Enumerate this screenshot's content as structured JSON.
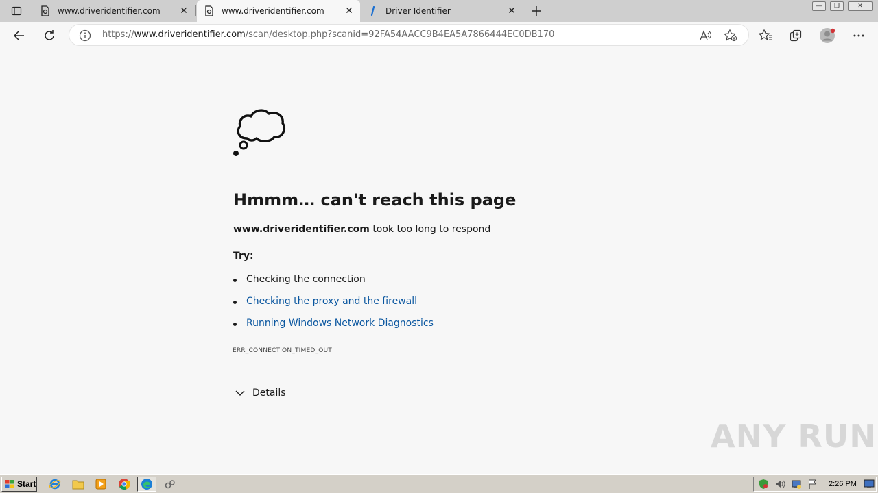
{
  "tabs": [
    {
      "title": "www.driveridentifier.com",
      "active": false
    },
    {
      "title": "www.driveridentifier.com",
      "active": true
    },
    {
      "title": "Driver Identifier",
      "active": false
    }
  ],
  "address": {
    "scheme": "https://",
    "host": "www.driveridentifier.com",
    "path": "/scan/desktop.php?scanid=92FA54AACC9B4EA5A7866444EC0DB170"
  },
  "error": {
    "title": "Hmmm… can't reach this page",
    "host": "www.driveridentifier.com",
    "message": "took too long to respond",
    "try_label": "Try:",
    "suggestions": [
      {
        "text": "Checking the connection",
        "link": false
      },
      {
        "text": "Checking the proxy and the firewall",
        "link": true
      },
      {
        "text": "Running Windows Network Diagnostics",
        "link": true
      }
    ],
    "code": "ERR_CONNECTION_TIMED_OUT",
    "details_label": "Details"
  },
  "watermark": "ANY RUN",
  "taskbar": {
    "start_label": "Start",
    "clock": "2:26 PM"
  },
  "colors": {
    "link": "#0b57a0",
    "tabstrip": "#cfcfcf",
    "taskbar": "#d4d0c8"
  }
}
